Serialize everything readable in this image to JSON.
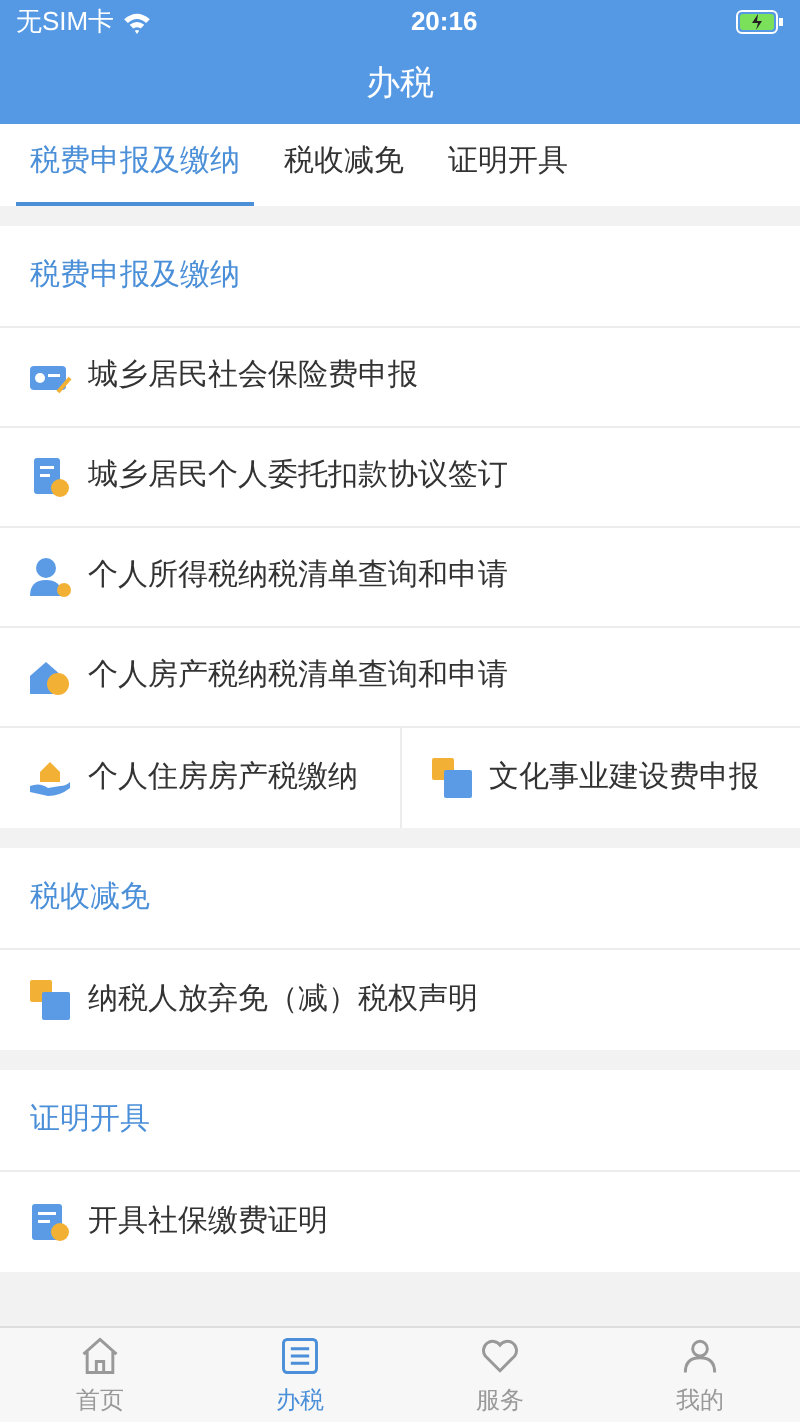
{
  "status_bar": {
    "carrier": "无SIM卡",
    "time": "20:16",
    "charging": true
  },
  "title": "办税",
  "tabs": [
    {
      "label": "税费申报及缴纳",
      "selected": true
    },
    {
      "label": "税收减免",
      "selected": false
    },
    {
      "label": "证明开具",
      "selected": false
    }
  ],
  "sections": [
    {
      "title": "税费申报及缴纳",
      "rows": [
        {
          "items": [
            {
              "kind": "card",
              "label": "城乡居民社会保险费申报"
            }
          ]
        },
        {
          "items": [
            {
              "kind": "document",
              "label": "城乡居民个人委托扣款协议签订"
            }
          ]
        },
        {
          "items": [
            {
              "kind": "person",
              "label": "个人所得税纳税清单查询和申请"
            }
          ]
        },
        {
          "items": [
            {
              "kind": "house",
              "label": "个人房产税纳税清单查询和申请"
            }
          ]
        },
        {
          "items": [
            {
              "kind": "hand",
              "label": "个人住房房产税缴纳"
            },
            {
              "kind": "squares",
              "label": "文化事业建设费申报"
            }
          ]
        }
      ]
    },
    {
      "title": "税收减免",
      "rows": [
        {
          "items": [
            {
              "kind": "squares",
              "label": "纳税人放弃免（减）税权声明"
            }
          ]
        }
      ]
    },
    {
      "title": "证明开具",
      "rows": [
        {
          "items": [
            {
              "kind": "certificate",
              "label": "开具社保缴费证明"
            }
          ]
        }
      ]
    }
  ],
  "bottom_nav": [
    {
      "kind": "home",
      "label": "首页",
      "selected": false
    },
    {
      "kind": "list",
      "label": "办税",
      "selected": true
    },
    {
      "kind": "heart",
      "label": "服务",
      "selected": false
    },
    {
      "kind": "person",
      "label": "我的",
      "selected": false
    }
  ]
}
